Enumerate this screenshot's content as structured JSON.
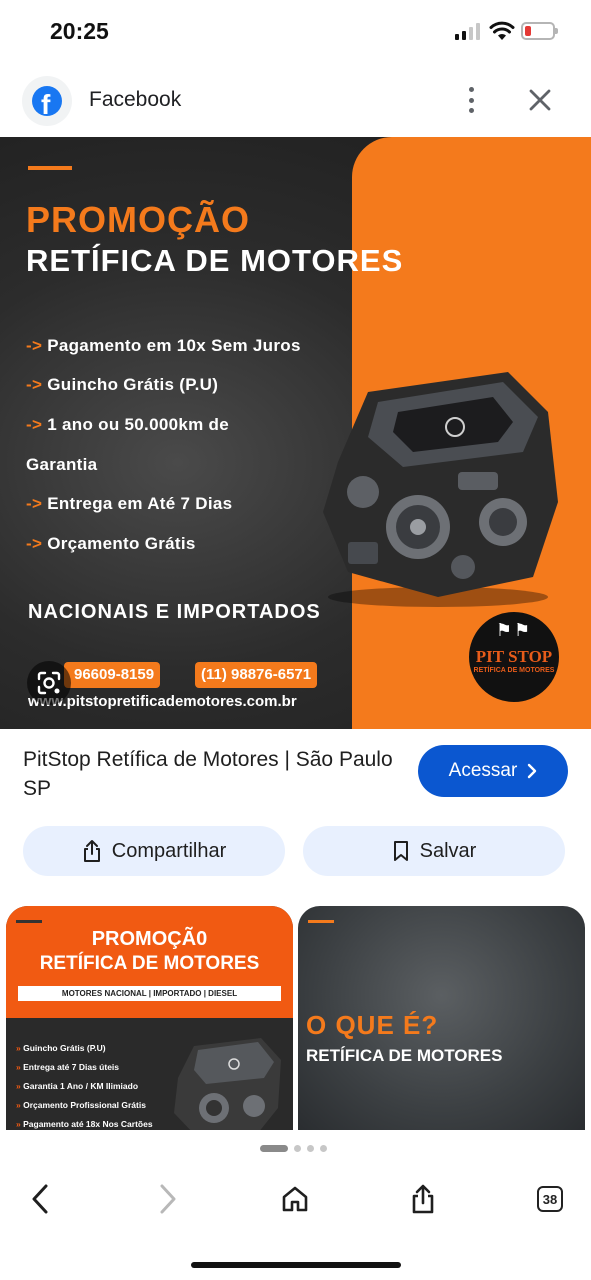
{
  "status_bar": {
    "time": "20:25"
  },
  "top_bar": {
    "site_name": "Facebook",
    "logo_letter": "f",
    "menu_icon": "kebab-menu-icon",
    "close_icon": "close-icon"
  },
  "hero": {
    "title_line1": "PROMOÇÃO",
    "title_line2": "RETÍFICA DE MOTORES",
    "bullets": [
      {
        "arrow": "->",
        "text": "Pagamento em 10x Sem Juros"
      },
      {
        "arrow": "->",
        "text": "Guincho Grátis (P.U)"
      },
      {
        "arrow": "->",
        "text": "1 ano ou 50.000km de"
      },
      {
        "arrow": "",
        "text": "Garantia"
      },
      {
        "arrow": "->",
        "text": "Entrega em Até 7 Dias"
      },
      {
        "arrow": "->",
        "text": "Orçamento Grátis"
      }
    ],
    "tagline": "NACIONAIS E IMPORTADOS",
    "phone1": "96609-8159",
    "phone2": "(11) 98876-6571",
    "url": "www.pitstopretificademotores.com.br",
    "logo_name": "PIT STOP",
    "logo_sub": "RETÍFICA DE MOTORES",
    "accent": "#f47a1c"
  },
  "result": {
    "title": "PitStop Retífica de Motores | São Paulo SP",
    "visit_label": "Acessar",
    "share_label": "Compartilhar",
    "save_label": "Salvar",
    "button_color": "#0b57d0"
  },
  "related": [
    {
      "title1": "PROMOÇÃ0",
      "title2": "RETÍFICA DE MOTORES",
      "strip": "MOTORES NACIONAL | IMPORTADO | DIESEL",
      "lines": [
        "Guincho Grátis (P.U)",
        "Entrega até 7 Dias úteis",
        "Garantia 1 Ano / KM Ilimiado",
        "Orçamento Profissional Grátis",
        "Pagamento até 18x Nos Cartões"
      ]
    },
    {
      "title1": "O QUE É?",
      "title2": "RETÍFICA DE MOTORES"
    }
  ],
  "pager": {
    "active_index": 0,
    "count": 4
  },
  "toolbar": {
    "back_icon": "back-arrow-icon",
    "forward_icon": "forward-arrow-icon",
    "home_icon": "home-icon",
    "share_icon": "share-icon",
    "tabs_count": "38"
  }
}
